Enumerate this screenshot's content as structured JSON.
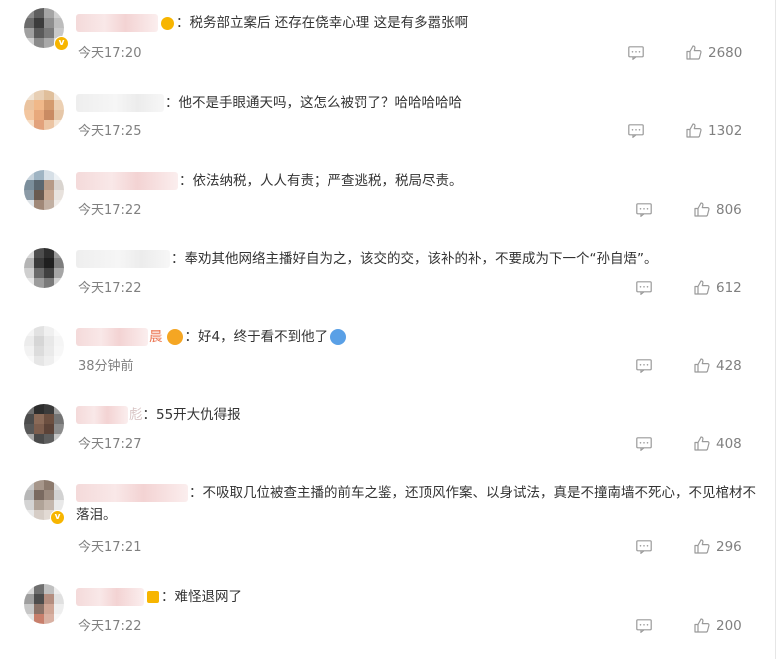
{
  "comments": [
    {
      "text": "：税务部立案后 还存在侥幸心理 这是有多嚣张啊",
      "time": "今天17:20",
      "likes": "2680"
    },
    {
      "text": "：他不是手眼通天吗，这怎么被罚了？哈哈哈哈哈",
      "time": "今天17:25",
      "likes": "1302"
    },
    {
      "text": "：依法纳税，人人有责；严查逃税，税局尽责。",
      "time": "今天17:22",
      "likes": "806"
    },
    {
      "text": "：奉劝其他网络主播好自为之，该交的交，该补的补，不要成为下一个“孙自焐”。",
      "time": "今天17:22",
      "likes": "612"
    },
    {
      "name_tail": "晨",
      "text": "：好4，终于看不到他了",
      "time": "38分钟前",
      "likes": "428"
    },
    {
      "name_tail": "彪",
      "text": "：55开大仇得报",
      "time": "今天17:27",
      "likes": "408"
    },
    {
      "text": "：不吸取几位被查主播的前车之鉴，还顶风作案、以身试法，真是不撞南墙不死心，不见棺材不落泪。",
      "time": "今天17:21",
      "likes": "296"
    },
    {
      "text": "：难怪退网了",
      "time": "今天17:22",
      "likes": "200"
    }
  ],
  "colors": {
    "accent_orange": "#f7b500",
    "muted_text": "#808080",
    "body_text": "#333333"
  },
  "icons": {
    "reply": "comment-icon",
    "like": "thumbs-up-icon",
    "verified": "verified-badge-icon"
  }
}
